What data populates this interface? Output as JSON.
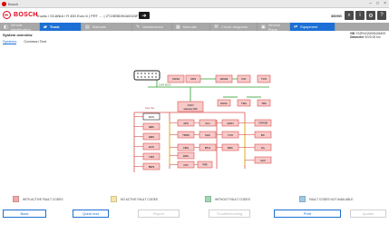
{
  "window": {
    "title": "Bosch"
  },
  "header": {
    "brand": "BOSCH",
    "breadcrumb": "Trucks / SCANIA / R 450 Euro 6 | PRT .... | 2T15EBD90A0024F70",
    "vehicle_code": "3609G"
  },
  "nav": {
    "tabs": [
      {
        "label": "Vehicle identification",
        "icon": "car-icon"
      },
      {
        "label": "Truck",
        "icon": "truck-icon"
      },
      {
        "label": "Manuals",
        "icon": "book-icon"
      },
      {
        "label": "Maintenance",
        "icon": "wrench-icon"
      },
      {
        "label": "Manuals",
        "icon": "doc-icon"
      },
      {
        "label": "Circuit diagrams",
        "icon": "circuit-icon"
      },
      {
        "label": "Service Plans",
        "icon": "plan-icon"
      },
      {
        "label": "Equipment",
        "icon": "plug-icon"
      }
    ]
  },
  "section": {
    "title": "System overview",
    "vin_label": "VIN",
    "vin_value": "YS2R4X20005426409",
    "odo_label": "Odometer",
    "odo_value": "9220.00 km"
  },
  "subtabs": [
    "Systems",
    "Common Text"
  ],
  "diagram": {
    "bus_label": "CAN BUS",
    "top_row": [
      "CDS2",
      "CDS",
      "ARGMI",
      "INC",
      "TCS"
    ],
    "mid_row": [
      "DHS2",
      "TMA",
      "TRS"
    ],
    "main": {
      "label": "COO",
      "sub": "Gateway (SR)"
    },
    "left_bus_label": "Cent. Ser",
    "left_col": [
      "DCS",
      "EBS",
      "EMS",
      "ECS",
      "TMS",
      "BWS"
    ],
    "col2": [
      "APS",
      "TPMS",
      "CMS",
      "ERS",
      "CST"
    ],
    "col2_tail": "PRR",
    "col3": [
      "VLC",
      "SHU",
      "BTUI",
      "PRR SCS"
    ],
    "col4": [
      "HMCI",
      "TCO",
      "BRC"
    ],
    "col5": [
      "UTI/HOM",
      "BC",
      "ICL",
      "AUX"
    ]
  },
  "legend": [
    {
      "label": "WITH ACTIVE FAULT CODES",
      "color": "#f0a8a8"
    },
    {
      "label": "NO ACTIVE FAULT CODES",
      "color": "#f5e6a8"
    },
    {
      "label": "WITHOUT FAULT CODES",
      "color": "#9fd9b3"
    },
    {
      "label": "FAULT CODES NOT AVAILABLE",
      "color": "#9fcbe6"
    }
  ],
  "buttons": [
    {
      "label": "Back"
    },
    {
      "label": "Quick test"
    },
    {
      "label": "Report"
    },
    {
      "label": "Troubleshooting"
    },
    {
      "label": "Print"
    },
    {
      "label": "Update"
    }
  ],
  "colors": {
    "accent": "#1c6fd4",
    "brand": "#e30016",
    "faultBox": "#f7c9c9",
    "faultBorder": "#d9534f"
  }
}
